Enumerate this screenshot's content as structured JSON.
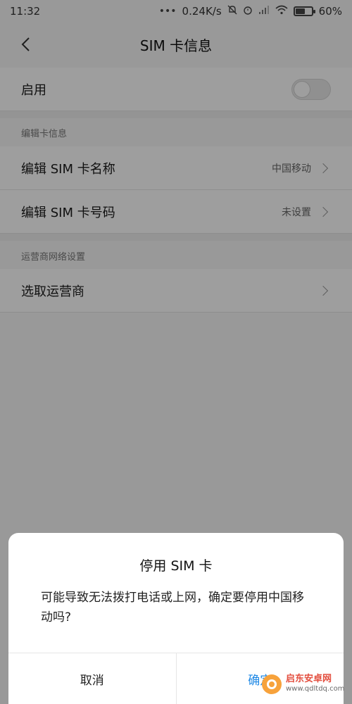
{
  "status_bar": {
    "time": "11:32",
    "dots": "•••",
    "speed": "0.24K/s",
    "battery_percent": "60%",
    "battery_level": 0.6
  },
  "header": {
    "title": "SIM  卡信息"
  },
  "enable_row": {
    "label": "启用",
    "toggle_on": false
  },
  "section_edit": {
    "label": "编辑卡信息",
    "items": [
      {
        "label": "编辑 SIM 卡名称",
        "value": "中国移动"
      },
      {
        "label": "编辑 SIM 卡号码",
        "value": "未设置"
      }
    ]
  },
  "section_carrier": {
    "label": "运营商网络设置",
    "items": [
      {
        "label": "选取运营商",
        "value": ""
      }
    ]
  },
  "dialog": {
    "title": "停用  SIM  卡",
    "message": "可能导致无法拨打电话或上网，确定要停用中国移动吗?",
    "cancel_label": "取消",
    "confirm_label": "确定"
  },
  "watermark": {
    "line1": "启东安卓网",
    "line2": "www.qdltdq.com"
  },
  "colors": {
    "accent": "#1e88e5",
    "overlay": "rgba(0,0,0,0.38)"
  }
}
